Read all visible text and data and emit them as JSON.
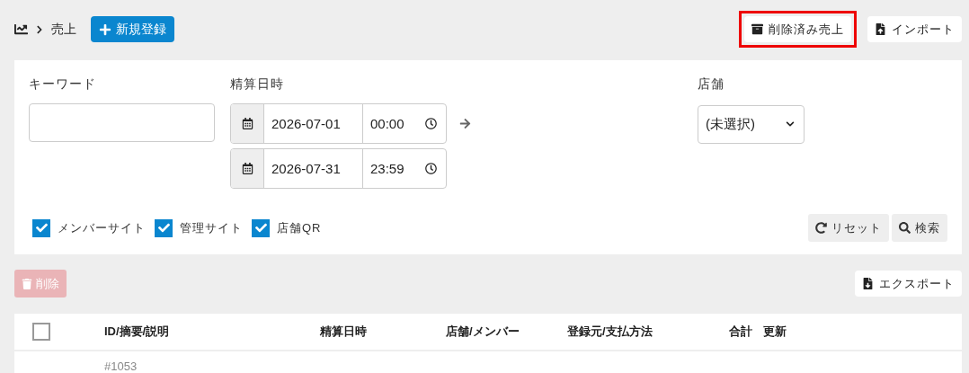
{
  "breadcrumb": {
    "current": "売上"
  },
  "new_button": {
    "label": "新規登録"
  },
  "header_actions": [
    {
      "kind": "archive",
      "label": "削除済み売上",
      "highlighted": true
    },
    {
      "kind": "import",
      "label": "インポート",
      "highlighted": false
    }
  ],
  "filters": {
    "keyword": {
      "label": "キーワード"
    },
    "settlement_datetime": {
      "label": "精算日時",
      "ranges": [
        {
          "date": "2026-07-01",
          "time": "00:00"
        },
        {
          "date": "2026-07-31",
          "time": "23:59"
        }
      ]
    },
    "store": {
      "label": "店舗",
      "value": "(未選択)"
    },
    "sources": [
      {
        "label": "メンバーサイト",
        "checked": true
      },
      {
        "label": "管理サイト",
        "checked": true
      },
      {
        "label": "店舗QR",
        "checked": true
      }
    ],
    "buttons": [
      {
        "kind": "reset",
        "label": "リセット"
      },
      {
        "kind": "search",
        "label": "検索"
      }
    ]
  },
  "delete_button": {
    "label": "削除",
    "disabled": true
  },
  "export_button": {
    "label": "エクスポート"
  },
  "table": {
    "select_all": {
      "checked": false
    },
    "columns": [
      "ID/摘要/説明",
      "精算日時",
      "店舗/メンバー",
      "登録元/支払方法",
      "合計",
      "更新"
    ],
    "rows": [
      {
        "id": "#1053"
      }
    ]
  }
}
